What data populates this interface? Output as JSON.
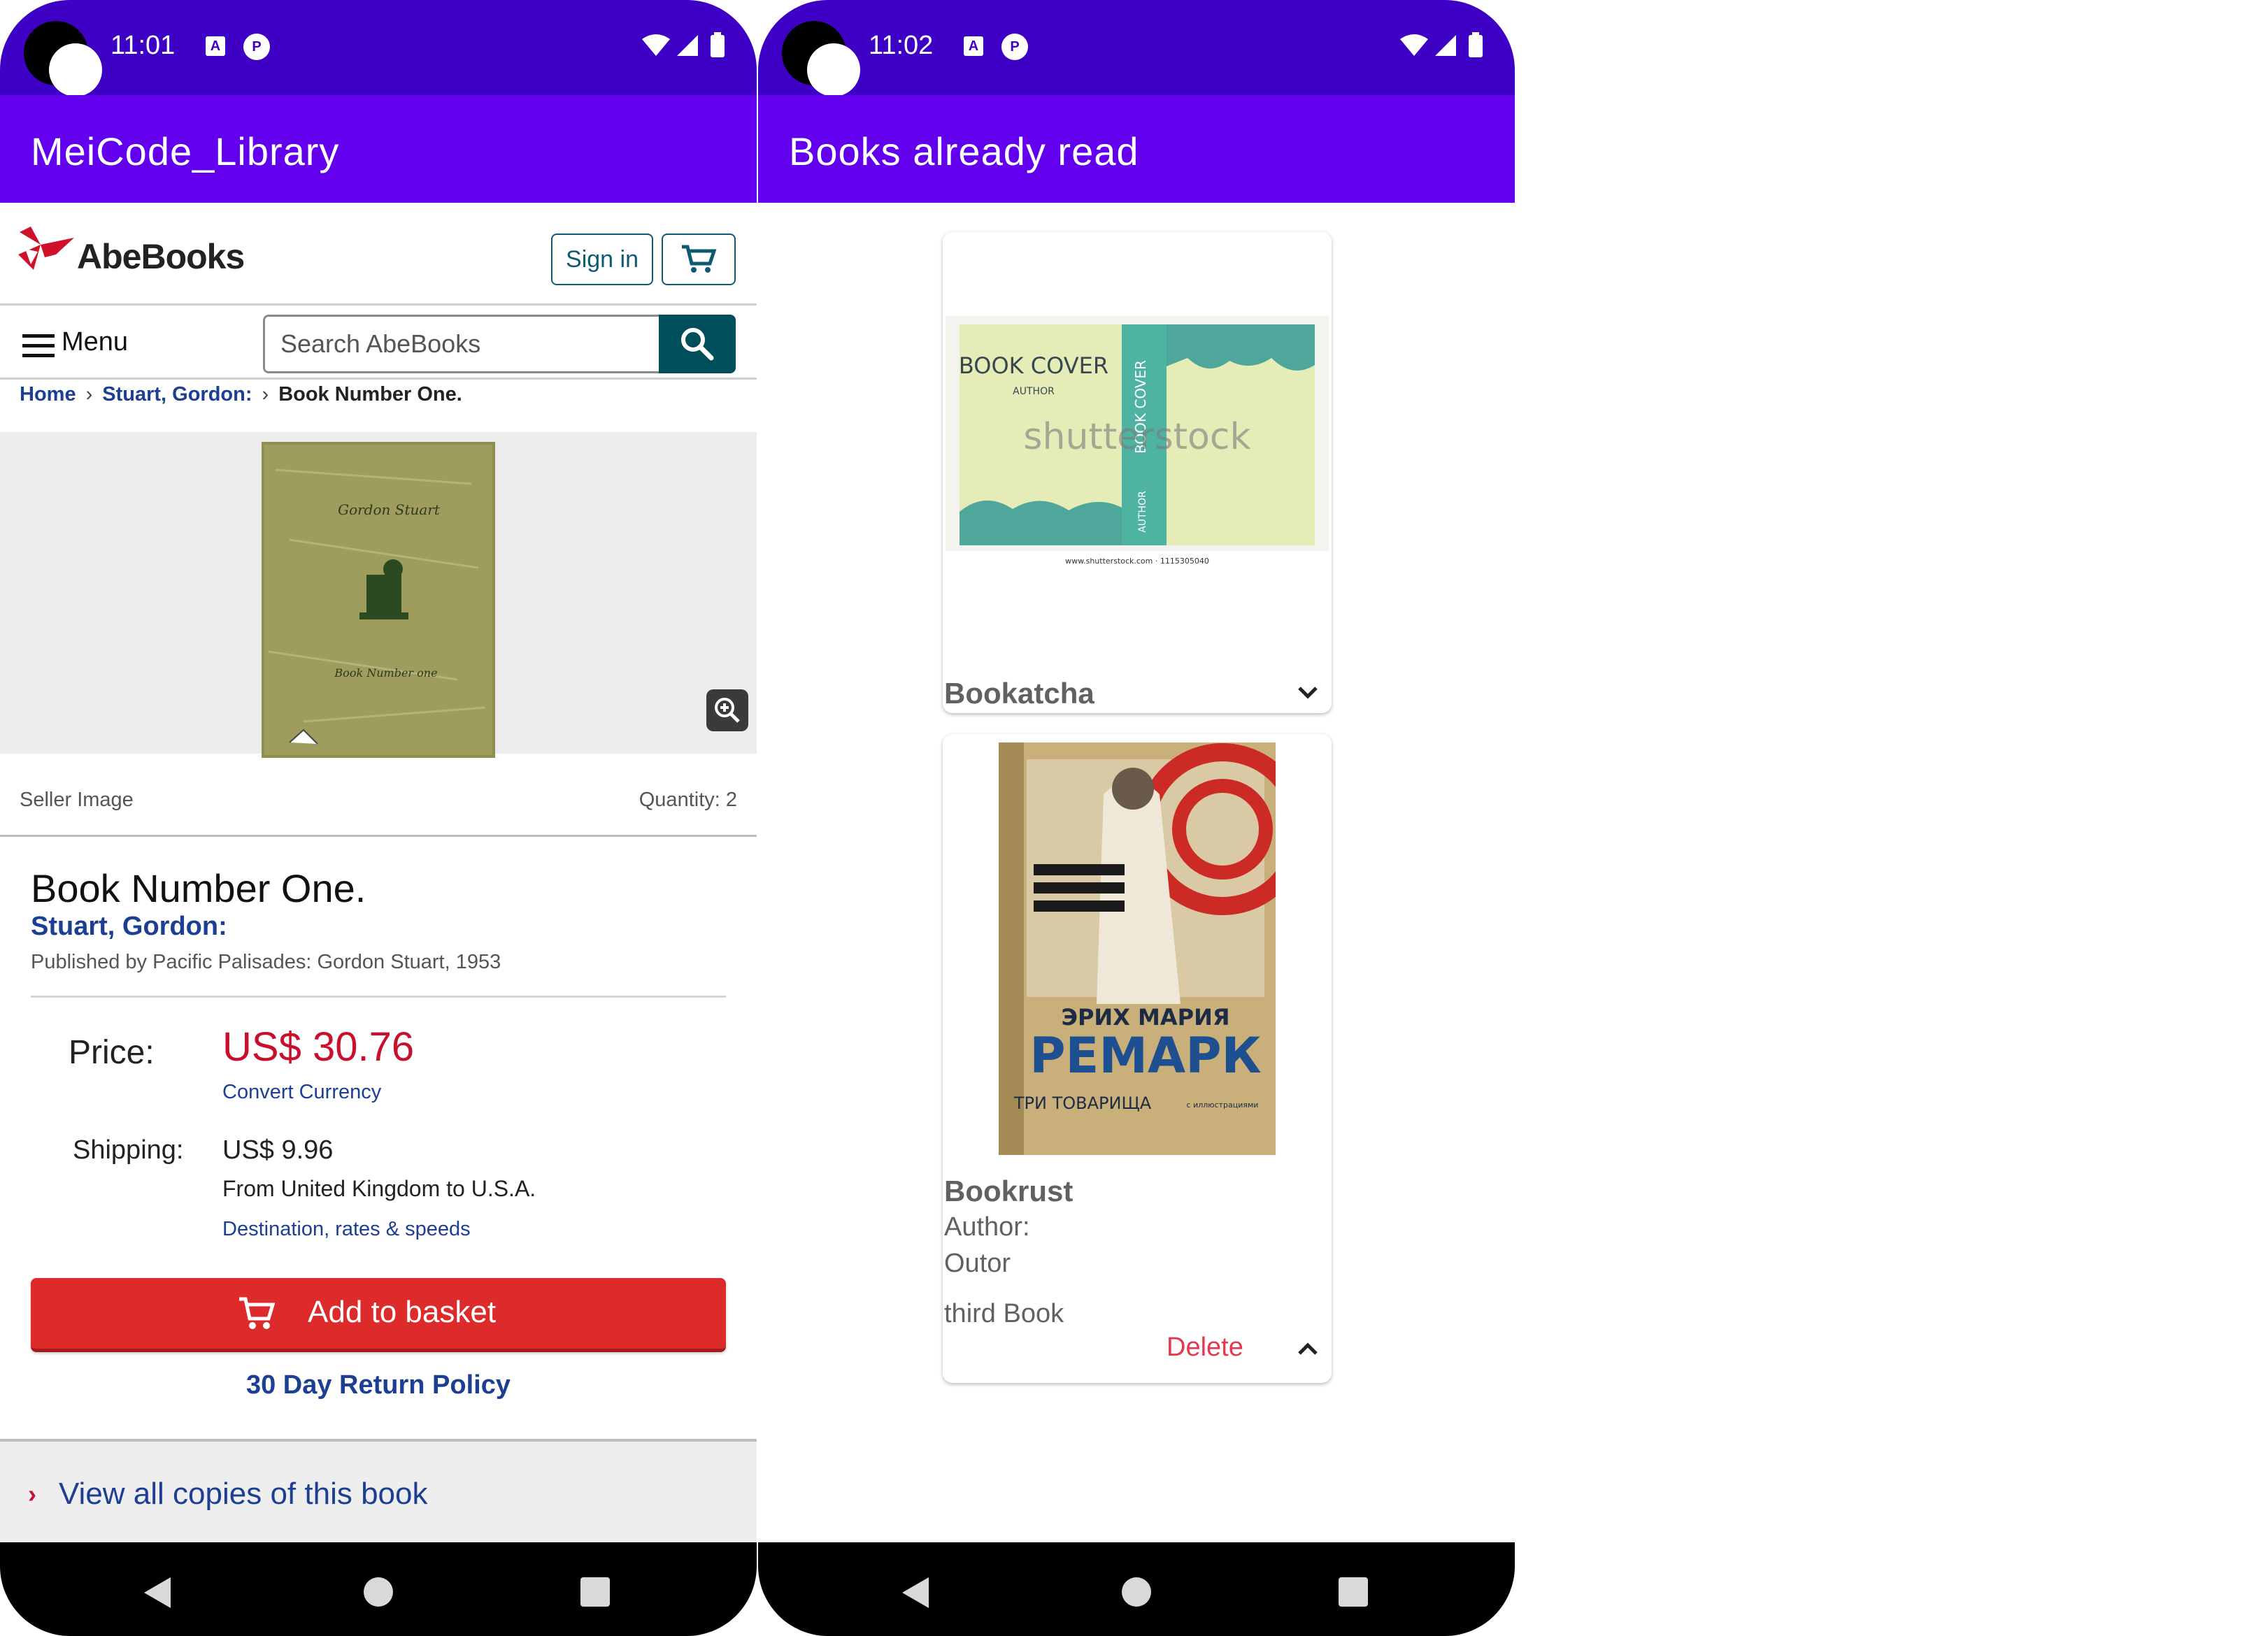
{
  "left_screen": {
    "status": {
      "time": "11:01",
      "icon1": "A",
      "icon2": "P",
      "right_icons": [
        "wifi-icon",
        "signal-icon",
        "battery-icon"
      ]
    },
    "app_title": "MeiCode_Library",
    "site": {
      "logo_text": "AbeBooks",
      "sign_in": "Sign in",
      "menu_label": "Menu",
      "search_placeholder": "Search AbeBooks",
      "breadcrumbs": [
        "Home",
        "Stuart, Gordon:",
        "Book Number One."
      ],
      "cover_text": {
        "author": "Gordon Stuart",
        "title": "Book Number one"
      },
      "seller_image": "Seller Image",
      "quantity": "Quantity: 2",
      "book_title": "Book Number One.",
      "book_author": "Stuart, Gordon:",
      "published": "Published by Pacific Palisades: Gordon Stuart, 1953",
      "price_label": "Price:",
      "price_value": "US$ 30.76",
      "convert_currency": "Convert Currency",
      "shipping_label": "Shipping:",
      "shipping_value": "US$ 9.96",
      "shipping_from": "From United Kingdom to U.S.A.",
      "destination_link": "Destination, rates & speeds",
      "add_to_basket": "Add to basket",
      "return_policy": "30 Day Return Policy",
      "view_all": "View all  copies of this book"
    }
  },
  "right_screen": {
    "status": {
      "time": "11:02",
      "icon1": "A",
      "icon2": "P",
      "right_icons": [
        "wifi-icon",
        "signal-icon",
        "battery-icon"
      ]
    },
    "app_title": "Books already read",
    "cards": [
      {
        "title": "Bookatcha",
        "expanded": false,
        "cover_text": {
          "cover": "BOOK COVER",
          "author": "AUTHOR",
          "spine": "BOOK COVER",
          "spine_author": "AUTHOR",
          "watermark": "shutterstock",
          "caption": "www.shutterstock.com · 1115305040"
        }
      },
      {
        "title": "Bookrust",
        "expanded": true,
        "author_label": "Author:",
        "author_value": "Outor",
        "description": "third Book",
        "delete_label": "Delete",
        "cover_text": {
          "author": "ЭРИХ МАРИЯ",
          "name": "РЕМАРК",
          "title": "ТРИ ТОВАРИЩА",
          "note": "с иллюстрациями"
        }
      }
    ]
  },
  "colors": {
    "status_bar": "#3f00c6",
    "app_bar": "#6200ee",
    "price": "#c8102e",
    "link": "#1c3f94",
    "add_button": "#dd2a2a",
    "delete": "#e53950"
  }
}
